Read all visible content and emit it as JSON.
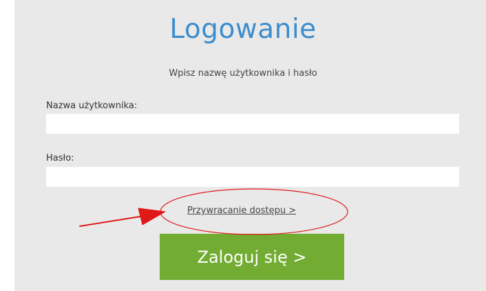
{
  "login": {
    "title": "Logowanie",
    "subtitle": "Wpisz nazwę użytkownika i hasło",
    "username_label": "Nazwa użytkownika:",
    "username_value": "",
    "password_label": "Hasło:",
    "password_value": "",
    "recover_link": "Przywracanie dostępu >",
    "submit_label": "Zaloguj się >"
  },
  "colors": {
    "panel_background": "#e9e9e9",
    "title": "#3c8dce",
    "button": "#72ac32",
    "annotation": "#e01818"
  }
}
